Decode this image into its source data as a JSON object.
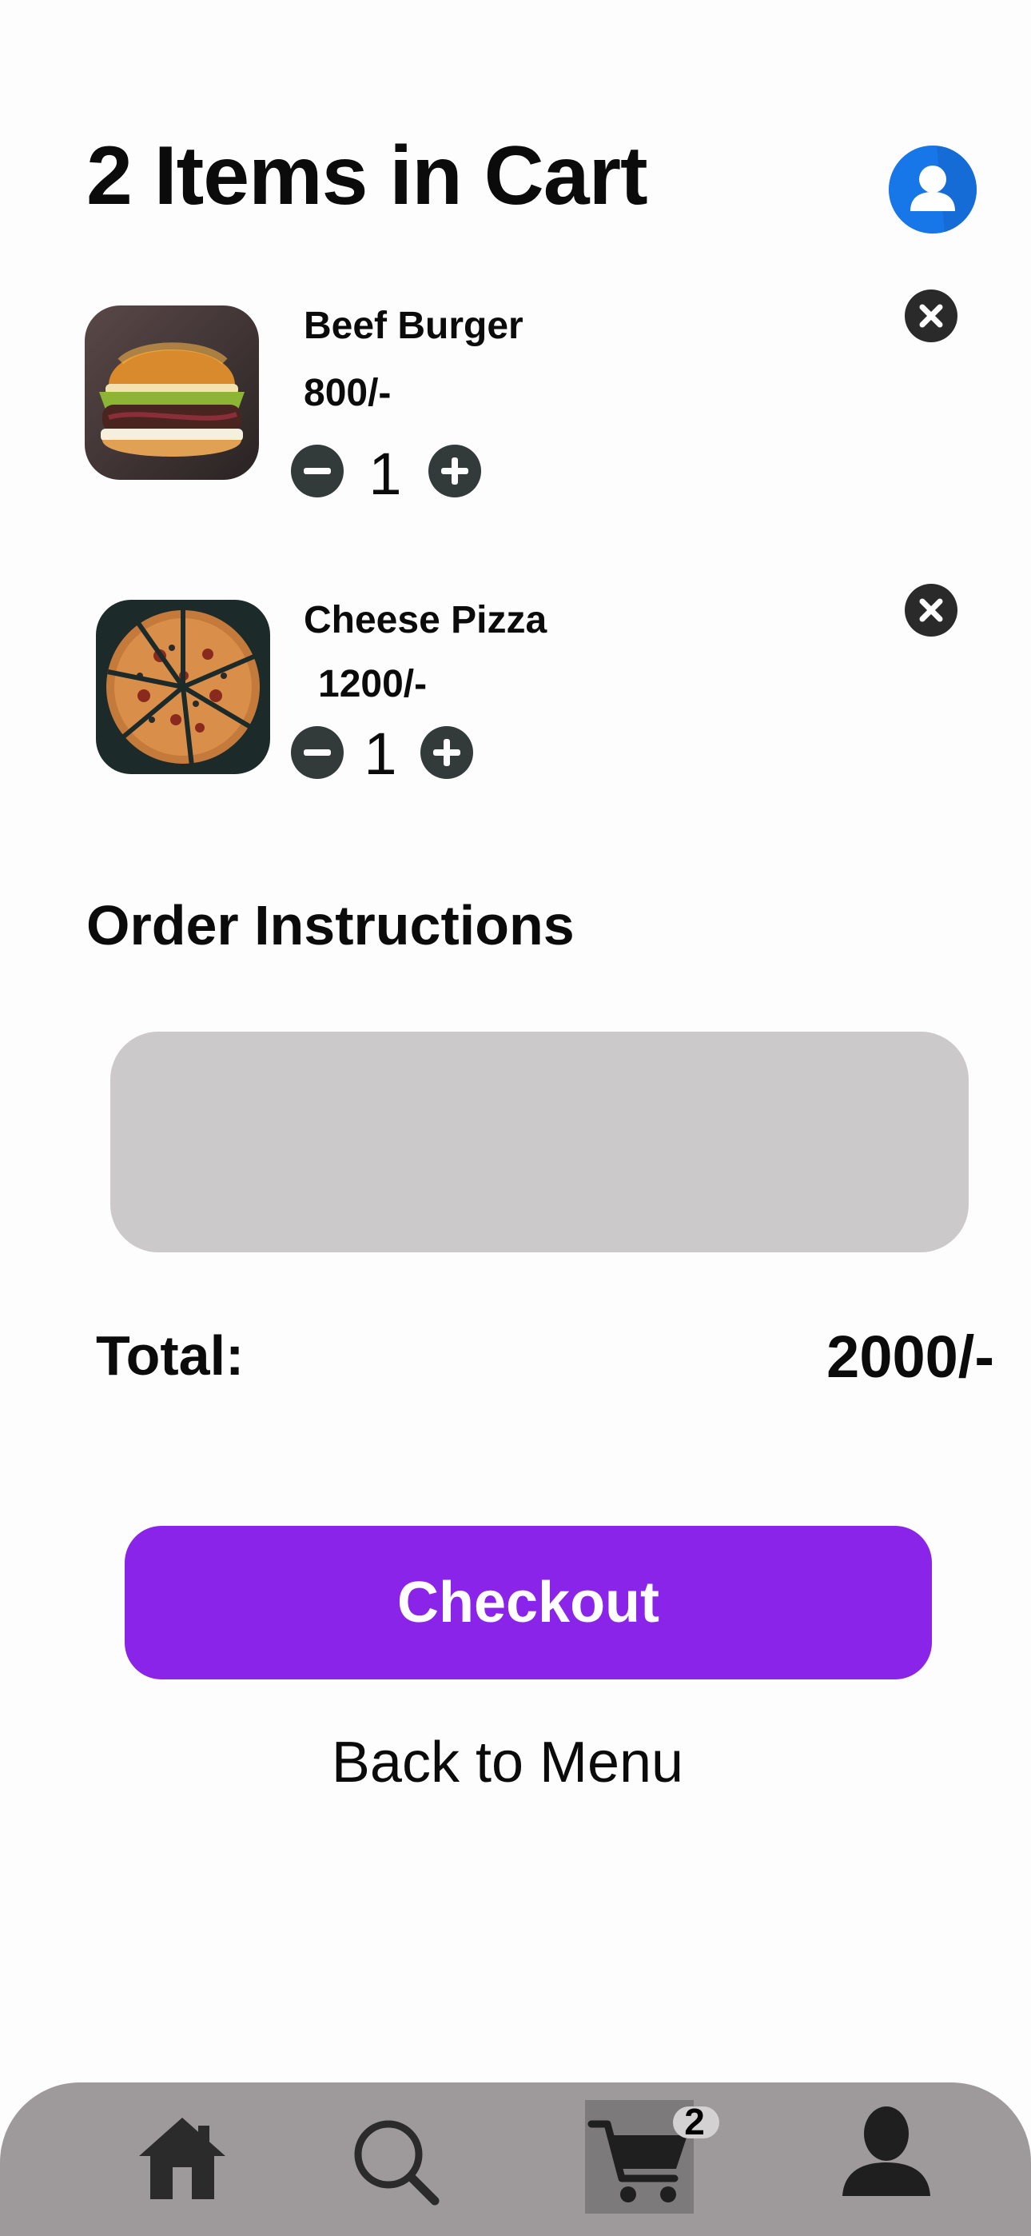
{
  "header": {
    "title": "2 Items in Cart",
    "avatar_icon": "user-avatar-icon"
  },
  "cart": {
    "items": [
      {
        "name": "Beef Burger",
        "price": "800/-",
        "quantity": "1",
        "image": "burger-photo"
      },
      {
        "name": "Cheese Pizza",
        "price": "1200/-",
        "quantity": "1",
        "image": "pizza-photo"
      }
    ]
  },
  "instructions": {
    "title": "Order Instructions",
    "value": "",
    "placeholder": ""
  },
  "summary": {
    "total_label": "Total:",
    "total_value": "2000/-"
  },
  "actions": {
    "checkout_label": "Checkout",
    "back_label": "Back to Menu"
  },
  "bottom_nav": {
    "items": [
      {
        "icon": "home-icon",
        "active": false
      },
      {
        "icon": "search-icon",
        "active": false
      },
      {
        "icon": "cart-icon",
        "active": true
      },
      {
        "icon": "profile-icon",
        "active": false
      }
    ],
    "cart_badge": "2"
  },
  "colors": {
    "accent": "#8a24e8",
    "avatar_blue": "#1877e8",
    "nav_bg": "#9e9a9b",
    "input_bg": "#cbc9ca",
    "stepper": "#333a3a"
  }
}
